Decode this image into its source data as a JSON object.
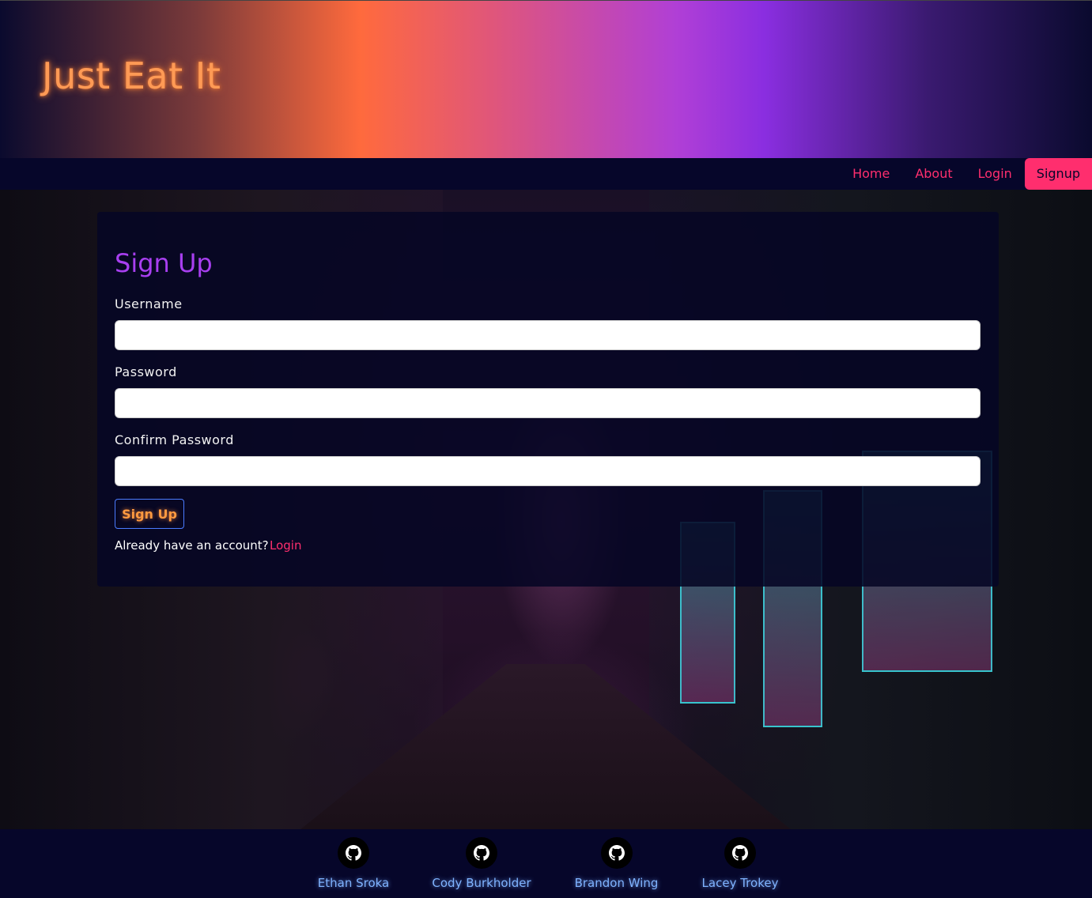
{
  "header": {
    "title": "Just Eat It"
  },
  "nav": {
    "items": [
      {
        "label": "Home"
      },
      {
        "label": "About"
      },
      {
        "label": "Login"
      },
      {
        "label": "Signup"
      }
    ]
  },
  "form": {
    "title": "Sign Up",
    "username_label": "Username",
    "username_value": "",
    "password_label": "Password",
    "password_value": "",
    "confirm_label": "Confirm Password",
    "confirm_value": "",
    "submit_label": "Sign Up",
    "already_text": "Already have an account?",
    "login_link": "Login"
  },
  "footer": {
    "developers": [
      {
        "name": "Ethan Sroka",
        "icon": "github-icon"
      },
      {
        "name": "Cody Burkholder",
        "icon": "github-icon"
      },
      {
        "name": "Brandon Wing",
        "icon": "github-icon"
      },
      {
        "name": "Lacey Trokey",
        "icon": "github-icon"
      }
    ]
  },
  "colors": {
    "accent": "#ff2e6e",
    "title_purple": "#a83ff0",
    "brand_orange": "#ff9a55",
    "background": "#06062a",
    "dev_link": "#7fb3ff"
  }
}
